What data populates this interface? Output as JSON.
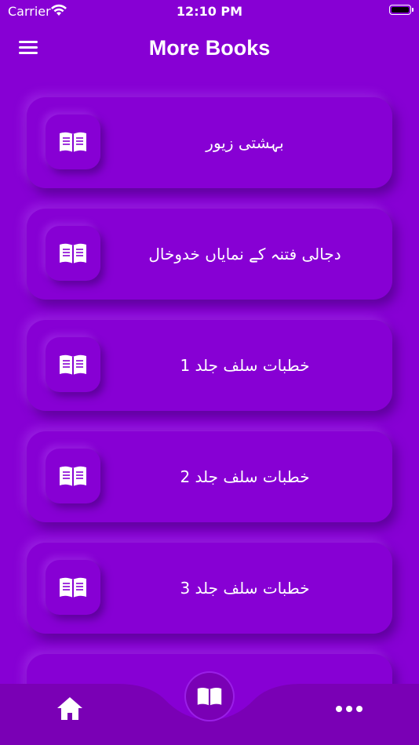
{
  "status_bar": {
    "carrier": "Carrier",
    "time": "12:10 PM"
  },
  "header": {
    "title": "More Books",
    "menu_icon": "hamburger-menu-icon"
  },
  "books": [
    {
      "title": "بہشتی زیور",
      "icon": "book-open-icon"
    },
    {
      "title": "دجالی فتنہ کے نمایاں خدوخال",
      "icon": "book-open-icon"
    },
    {
      "title": "خطبات سلف جلد 1",
      "icon": "book-open-icon"
    },
    {
      "title": "خطبات سلف جلد 2",
      "icon": "book-open-icon"
    },
    {
      "title": "خطبات سلف جلد 3",
      "icon": "book-open-icon"
    }
  ],
  "bottom_nav": {
    "items": [
      {
        "icon": "home-icon"
      },
      {
        "icon": "book-open-icon",
        "active": true
      },
      {
        "icon": "more-dots-icon"
      }
    ]
  },
  "colors": {
    "background": "#8700d4",
    "bottom_bar": "#7a00b5"
  }
}
